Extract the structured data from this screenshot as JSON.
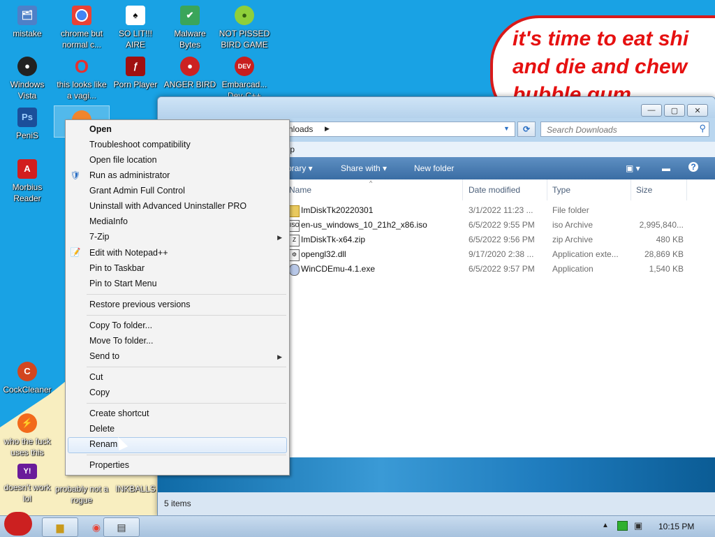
{
  "desktop": {
    "icons": [
      {
        "label": "mistake",
        "glyph": "🗂",
        "color": "#4e80c8"
      },
      {
        "label": "chrome but normal c...",
        "glyph": "◉",
        "color": "#e94235"
      },
      {
        "label": "SO LIT!!! AIRE",
        "glyph": "♠",
        "color": "#ffffff"
      },
      {
        "label": "Malware Bytes",
        "glyph": "✔",
        "color": "#3aa55a"
      },
      {
        "label": "NOT PISSED BIRD GAME",
        "glyph": "🐷",
        "color": "#8fcf3a"
      },
      {
        "label": "Windows Vista",
        "glyph": "●",
        "color": "#222222"
      },
      {
        "label": "this looks like a vagi...",
        "glyph": "O",
        "color": "#e53030"
      },
      {
        "label": "Porn Player",
        "glyph": "ƒ",
        "color": "#a01010"
      },
      {
        "label": "ANGER BIRD",
        "glyph": "●",
        "color": "#cc2222"
      },
      {
        "label": "Embarcad... Dev-C++",
        "glyph": "DEV",
        "color": "#c81e1e"
      },
      {
        "label": "PeniS",
        "glyph": "Ps",
        "color": "#1b4f9a"
      },
      {
        "label": "Morbius Reader",
        "glyph": "A",
        "color": "#d21e1e"
      },
      {
        "label": "CockCleaner",
        "glyph": "C",
        "color": "#d2461e"
      },
      {
        "label": "who the fuck uses this",
        "glyph": "⚡",
        "color": "#f26a1b"
      },
      {
        "label": "doesn't work lol",
        "glyph": "Y!",
        "color": "#6a1b9a"
      },
      {
        "label": "probably not a rogue",
        "glyph": "",
        "color": "#f8eec0"
      },
      {
        "label": "INKBALLS",
        "glyph": "",
        "color": "#f8eec0"
      }
    ],
    "bubble_text": "it's time to eat shi\nand die and chew\nbubble gum"
  },
  "explorer": {
    "address_crumb": "nloads",
    "search_placeholder": "Search Downloads",
    "menu_help": "elp",
    "toolbar": {
      "library": "brary",
      "share_with": "Share with",
      "new_folder": "New folder"
    },
    "columns": {
      "name": "Name",
      "date": "Date modified",
      "type": "Type",
      "size": "Size"
    },
    "files": [
      {
        "name": "ImDiskTk20220301",
        "date": "3/1/2022 11:23 ...",
        "type": "File folder",
        "size": "",
        "icon": "folder-icon"
      },
      {
        "name": "en-us_windows_10_21h2_x86.iso",
        "date": "6/5/2022 9:55 PM",
        "type": "iso Archive",
        "size": "2,995,840...",
        "icon": "iso-icon"
      },
      {
        "name": "ImDiskTk-x64.zip",
        "date": "6/5/2022 9:56 PM",
        "type": "zip Archive",
        "size": "480 KB",
        "icon": "zip-icon"
      },
      {
        "name": "opengl32.dll",
        "date": "9/17/2020 2:38 ...",
        "type": "Application exte...",
        "size": "28,869 KB",
        "icon": "dll-icon"
      },
      {
        "name": "WinCDEmu-4.1.exe",
        "date": "6/5/2022 9:57 PM",
        "type": "Application",
        "size": "1,540 KB",
        "icon": "exe-icon"
      }
    ],
    "status": "5 items"
  },
  "context_menu": {
    "open": "Open",
    "troubleshoot": "Troubleshoot compatibility",
    "open_location": "Open file location",
    "run_admin": "Run as administrator",
    "grant_admin": "Grant Admin Full Control",
    "uninstall": "Uninstall with Advanced Uninstaller PRO",
    "mediainfo": "MediaInfo",
    "sevenzip": "7-Zip",
    "notepad": "Edit with Notepad++",
    "pin_taskbar": "Pin to Taskbar",
    "pin_start": "Pin to Start Menu",
    "restore": "Restore previous versions",
    "copy_to": "Copy To folder...",
    "move_to": "Move To folder...",
    "send_to": "Send to",
    "cut": "Cut",
    "copy": "Copy",
    "create_shortcut": "Create shortcut",
    "delete": "Delete",
    "rename": "Renam",
    "properties": "Properties"
  },
  "taskbar": {
    "clock": "10:15 PM"
  }
}
